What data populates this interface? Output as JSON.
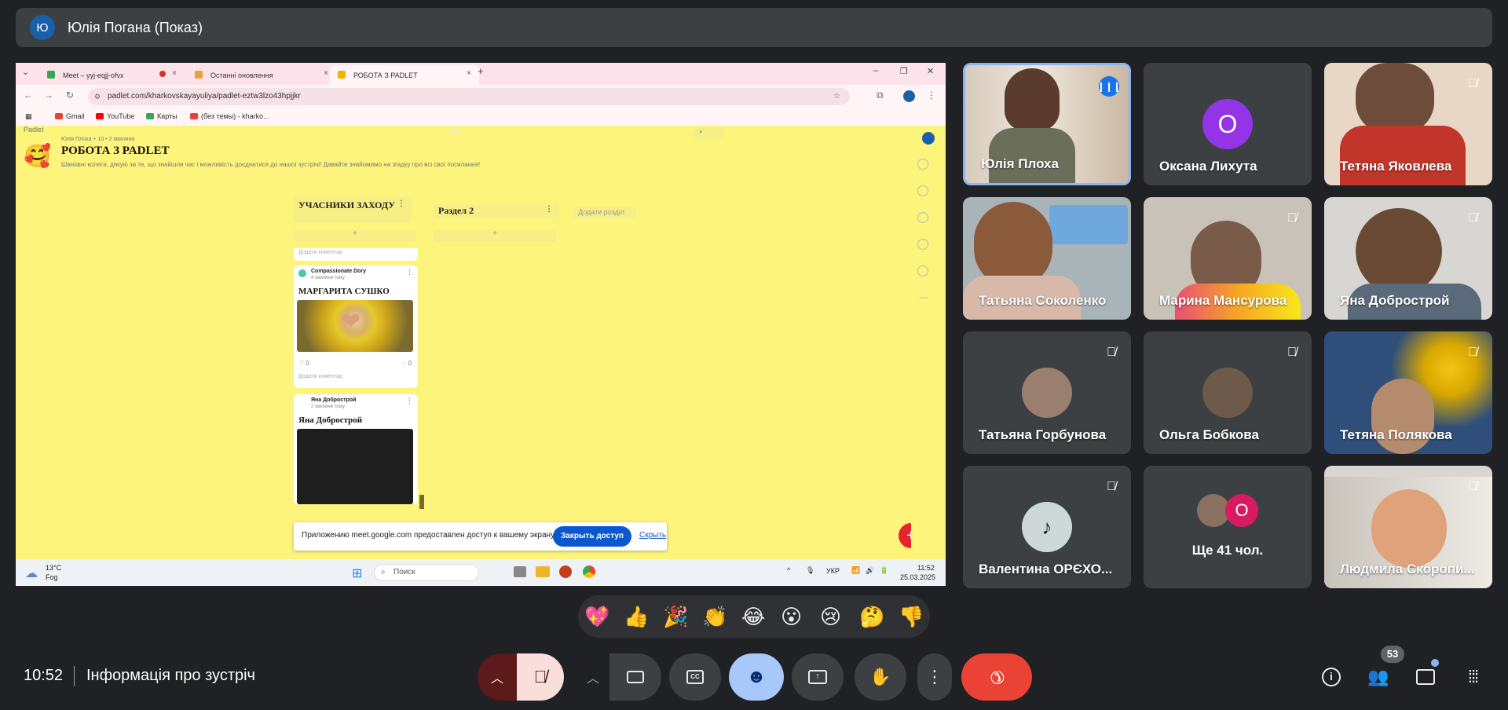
{
  "presenter": {
    "initial": "Ю",
    "title": "Юлія Погана (Показ)"
  },
  "browser": {
    "tabs": [
      {
        "label": "Meet – yyj-eqjj-ofvx",
        "fav": "#34a853"
      },
      {
        "label": "Останні оновлення",
        "fav": "#e8a33b"
      },
      {
        "label": "РОБОТА З PADLET",
        "fav": "#f2b200"
      }
    ],
    "url": "padlet.com/kharkovskayayuliya/padlet-eztw3lzo43hpjjkr",
    "bookmarks": [
      "Gmail",
      "YouTube",
      "Карты",
      "(без темы) - kharko..."
    ]
  },
  "padlet": {
    "brand": "Padlet",
    "author_line": "Юлія Плоха + 10 • 2 хвилини",
    "title": "РОБОТА З PADLET",
    "description": "Шановні колеги, дякую за те, що знайшли час і можливість доєднатися до нашої зустрічі! Давайте знайомимо на згадку про всі свої посилання!",
    "section1": "УЧАСНИКИ ЗАХОДУ",
    "section2": "Раздел 2",
    "add_section": "Додати розділ",
    "add_comment": "Додати коментар",
    "card1": {
      "author": "Compassionate Dory",
      "time": "4 хвилини тому",
      "title": "МАРГАРИТА СУШКО",
      "likes": "0",
      "comments": "0",
      "add_comment": "Додати коментар"
    },
    "card2": {
      "author": "Яна Добрострой",
      "time": "2 хвилини тому",
      "title": "Яна Добрострой"
    }
  },
  "toast": {
    "text": "Приложению meet.google.com предоставлен доступ к вашему экрану.",
    "primary": "Закрыть доступ",
    "secondary": "Скрыть"
  },
  "taskbar": {
    "temp": "13°C",
    "weather": "Fog",
    "search": "Поиск",
    "lang": "УКР",
    "time": "11:52",
    "date": "25.03.2025"
  },
  "participants": [
    {
      "name": "Юлія Плоха",
      "muted": false,
      "speaking": true
    },
    {
      "name": "Оксана Лихута",
      "initial": "О",
      "color": "#9334e6",
      "muted": false
    },
    {
      "name": "Тетяна Яковлева",
      "muted": true
    },
    {
      "name": "Татьяна Соколенко",
      "muted": false
    },
    {
      "name": "Марина Мансурова",
      "muted": true
    },
    {
      "name": "Яна Добрострой",
      "muted": true
    },
    {
      "name": "Татьяна Горбунова",
      "muted": true
    },
    {
      "name": "Ольга Бобкова",
      "muted": true
    },
    {
      "name": "Тетяна Полякова",
      "muted": true
    },
    {
      "name": "Валентина ОРЄХО...",
      "muted": true
    },
    {
      "name": "Ще 41 чол.",
      "initial": "О"
    },
    {
      "name": "Людмила Скоропи...",
      "muted": true
    }
  ],
  "reactions": [
    "💖",
    "👍",
    "🎉",
    "👏",
    "😂",
    "😮",
    "😢",
    "🤔",
    "👎"
  ],
  "bottom": {
    "time": "10:52",
    "meeting_info": "Інформація про зустріч",
    "participants_count": "53"
  },
  "colors": {
    "hangup": "#ea4335",
    "active_blue": "#a8c7fa",
    "mic_muted_bg": "#f9dedc",
    "padlet_bg": "#fdf47c"
  }
}
